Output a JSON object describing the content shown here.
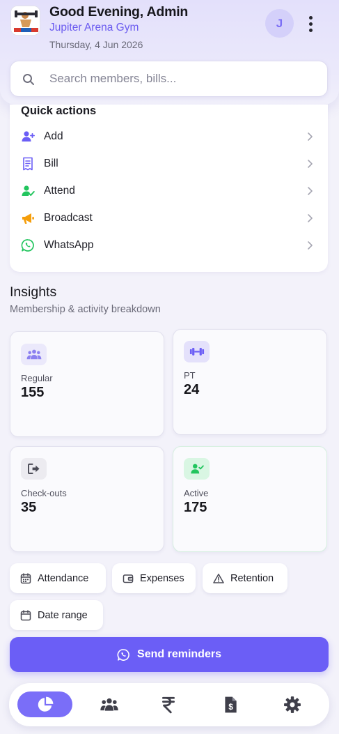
{
  "header": {
    "greeting": "Good Evening, Admin",
    "gym_name": "Jupiter Arena Gym",
    "date": "Thursday, 4 Jun 2026",
    "avatar_initial": "J"
  },
  "search": {
    "placeholder": "Search members, bills..."
  },
  "quick_actions": {
    "title": "Quick actions",
    "items": [
      {
        "label": "Add",
        "icon": "add-user-icon"
      },
      {
        "label": "Bill",
        "icon": "bill-icon"
      },
      {
        "label": "Attend",
        "icon": "attend-icon"
      },
      {
        "label": "Broadcast",
        "icon": "megaphone-icon"
      },
      {
        "label": "WhatsApp",
        "icon": "whatsapp-icon"
      }
    ]
  },
  "insights": {
    "title": "Insights",
    "subtitle": "Membership & activity breakdown",
    "stats": [
      {
        "label": "Regular",
        "value": "155",
        "icon": "users-icon"
      },
      {
        "label": "PT",
        "value": "24",
        "icon": "dumbbell-icon"
      },
      {
        "label": "Check-outs",
        "value": "35",
        "icon": "sign-out-icon"
      },
      {
        "label": "Active",
        "value": "175",
        "icon": "user-check-icon"
      }
    ]
  },
  "filters": [
    {
      "label": "Attendance",
      "icon": "calendar-icon"
    },
    {
      "label": "Expenses",
      "icon": "wallet-icon"
    },
    {
      "label": "Retention",
      "icon": "warning-icon"
    },
    {
      "label": "Date range",
      "icon": "calendar-icon"
    }
  ],
  "cta": {
    "label": "Send reminders",
    "icon": "whatsapp-icon"
  },
  "bottom_nav": {
    "items": [
      {
        "name": "dashboard",
        "icon": "pie-chart-icon",
        "active": true
      },
      {
        "name": "members",
        "icon": "users-icon",
        "active": false
      },
      {
        "name": "payments",
        "icon": "rupee-icon",
        "active": false
      },
      {
        "name": "invoices",
        "icon": "invoice-dollar-icon",
        "active": false
      },
      {
        "name": "settings",
        "icon": "gear-icon",
        "active": false
      }
    ]
  },
  "colors": {
    "accent": "#6b5ef6",
    "green": "#22c55e",
    "orange": "#f59e0b",
    "header_bg": "#e3e0fb"
  }
}
